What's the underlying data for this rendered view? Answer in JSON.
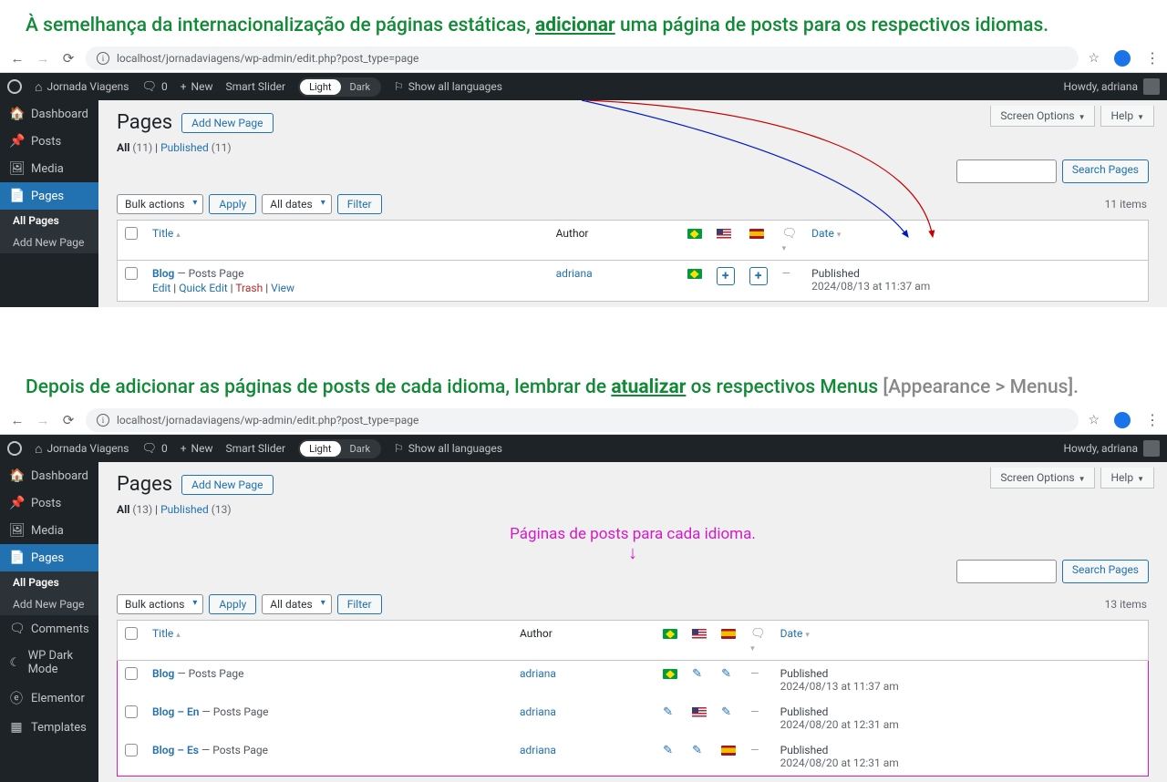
{
  "annotations": {
    "top": "À semelhança da internacionalização de páginas estáticas, ",
    "top_u": "adicionar",
    "top_rest": " uma página de posts para os respectivos idiomas.",
    "mid": "Depois de adicionar as páginas de posts de cada idioma, lembrar de ",
    "mid_u": "atualizar",
    "mid_rest": " os respectivos Menus ",
    "mid_gray": "[Appearance > Menus].",
    "magenta": "Páginas de posts para cada idioma."
  },
  "browser": {
    "url": "localhost/jornadaviagens/wp-admin/edit.php?post_type=page"
  },
  "adminbar": {
    "site": "Jornada Viagens",
    "comments": "0",
    "new": "New",
    "slider": "Smart Slider",
    "light": "Light",
    "dark": "Dark",
    "show_lang": "Show all languages",
    "howdy": "Howdy, adriana"
  },
  "sidebar": {
    "dashboard": "Dashboard",
    "posts": "Posts",
    "media": "Media",
    "pages": "Pages",
    "all_pages": "All Pages",
    "add_new": "Add New Page",
    "comments": "Comments",
    "darkmode": "WP Dark Mode",
    "elementor": "Elementor",
    "templates": "Templates"
  },
  "page": {
    "title": "Pages",
    "add_new": "Add New Page",
    "tabs": {
      "screen": "Screen Options",
      "help": "Help"
    },
    "filters": {
      "bulk": "Bulk actions",
      "apply": "Apply",
      "dates": "All dates",
      "filter": "Filter"
    },
    "search_btn": "Search Pages",
    "cols": {
      "title": "Title",
      "author": "Author",
      "date": "Date"
    }
  },
  "shot1": {
    "counts": {
      "all_lbl": "All",
      "all": "(11)",
      "pub_lbl": "Published",
      "pub": "(11)"
    },
    "items": "11 items",
    "row": {
      "title": "Blog",
      "suffix": " — Posts Page",
      "author": "adriana",
      "actions": {
        "edit": "Edit",
        "quick": "Quick Edit",
        "trash": "Trash",
        "view": "View"
      },
      "date_status": "Published",
      "date": "2024/08/13 at 11:37 am"
    }
  },
  "shot2": {
    "counts": {
      "all_lbl": "All",
      "all": "(13)",
      "pub_lbl": "Published",
      "pub": "(13)"
    },
    "items": "13 items",
    "rows": [
      {
        "title": "Blog",
        "suffix": " — Posts Page",
        "author": "adriana",
        "date_status": "Published",
        "date": "2024/08/13 at 11:37 am",
        "langs": [
          "br",
          "plus",
          "plus"
        ],
        "icons": [
          "br-flag",
          "pencil",
          "pencil"
        ]
      },
      {
        "title": "Blog – En",
        "suffix": " — Posts Page",
        "author": "adriana",
        "date_status": "Published",
        "date": "2024/08/20 at 12:31 am",
        "icons": [
          "pencil",
          "us-flag",
          "pencil"
        ]
      },
      {
        "title": "Blog – Es",
        "suffix": " — Posts Page",
        "author": "adriana",
        "date_status": "Published",
        "date": "2024/08/20 at 12:31 am",
        "icons": [
          "pencil",
          "pencil",
          "es-flag"
        ]
      }
    ]
  }
}
